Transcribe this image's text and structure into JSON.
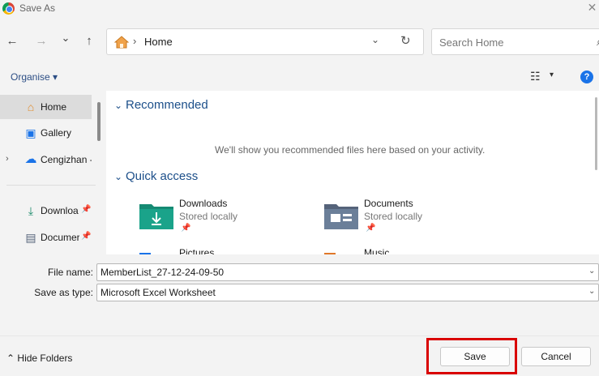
{
  "window": {
    "title": "Save As",
    "close_glyph": "✕"
  },
  "nav": {
    "back_glyph": "←",
    "forward_glyph": "→",
    "recent_glyph": "⌄",
    "up_glyph": "↑",
    "address": "Home",
    "address_separator": "›",
    "dropdown_glyph": "⌄",
    "refresh_glyph": "↻",
    "search_placeholder": "Search Home",
    "search_glyph": "⌕"
  },
  "toolbar": {
    "organise_label": "Organise ▾",
    "view_glyph": "☷",
    "view_chev": "▾",
    "help_glyph": "?"
  },
  "sidebar": {
    "items": [
      {
        "label": "Home",
        "icon": "home-icon",
        "glyph": "⌂",
        "color": "#e08b2a"
      },
      {
        "label": "Gallery",
        "icon": "gallery-icon",
        "glyph": "▣",
        "color": "#1a73e8"
      },
      {
        "label": "Cengizhan -",
        "icon": "onedrive-icon",
        "glyph": "☁",
        "color": "#1a73e8",
        "expand_glyph": "›"
      },
      {
        "label": "Downloa",
        "icon": "download-icon",
        "glyph": "⤓",
        "color": "#1a8a6a",
        "pin_glyph": "📌"
      },
      {
        "label": "Documer",
        "icon": "document-icon",
        "glyph": "▤",
        "color": "#55637a",
        "pin_glyph": "📌"
      }
    ]
  },
  "main": {
    "recommended": {
      "chev": "⌄",
      "title": "Recommended",
      "message": "We'll show you recommended files here based on your activity."
    },
    "quick_access": {
      "chev": "⌄",
      "title": "Quick access",
      "items": [
        {
          "name": "Downloads",
          "sub": "Stored locally",
          "pin": "📌",
          "color": "#1aa38a"
        },
        {
          "name": "Documents",
          "sub": "Stored locally",
          "pin": "📌",
          "color": "#6b7f99"
        },
        {
          "name": "Pictures",
          "color": "#1a73e8"
        },
        {
          "name": "Music",
          "color": "#e0782a"
        }
      ]
    }
  },
  "form": {
    "file_name_label": "File name:",
    "file_name_value": "MemberList_27-12-24-09-50",
    "type_label": "Save as type:",
    "type_value": "Microsoft Excel Worksheet",
    "chev": "⌄"
  },
  "footer": {
    "hide_folders_label": "Hide Folders",
    "hide_glyph": "⌃",
    "save_label": "Save",
    "cancel_label": "Cancel"
  },
  "colors": {
    "accent": "#1c4f8a",
    "highlight": "#d90000"
  }
}
